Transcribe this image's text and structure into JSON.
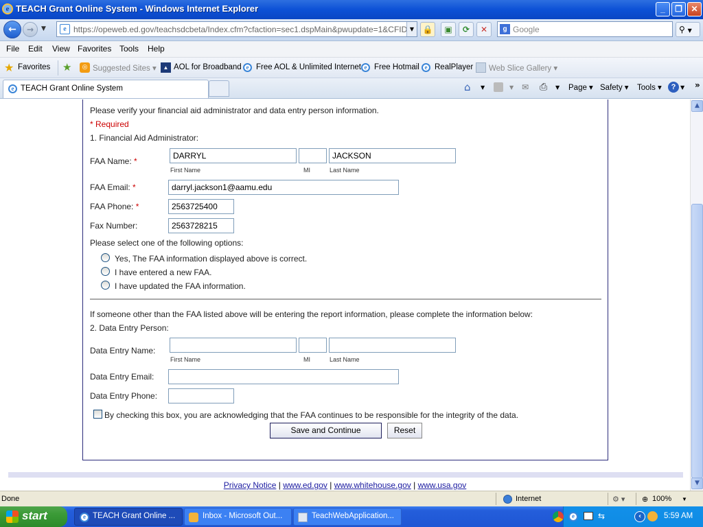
{
  "window": {
    "title": "TEACH Grant Online System - Windows Internet Explorer"
  },
  "navbar": {
    "url": "https://opeweb.ed.gov/teachsdcbeta/Index.cfm?cfaction=sec1.dspMain&pwupdate=1&CFID=4792",
    "search_placeholder": "Google"
  },
  "menu": [
    "File",
    "Edit",
    "View",
    "Favorites",
    "Tools",
    "Help"
  ],
  "favorites": {
    "label": "Favorites",
    "items": [
      "Suggested Sites ▾",
      "AOL for Broadband",
      "Free AOL & Unlimited Internet",
      "Free Hotmail",
      "RealPlayer",
      "Web Slice Gallery ▾"
    ]
  },
  "tabs": {
    "active_tab": "TEACH Grant Online System",
    "tools": [
      "Page ▾",
      "Safety ▾",
      "Tools ▾"
    ]
  },
  "form": {
    "intro": "Please verify your financial aid administrator and data entry person information.",
    "required_note": "* Required",
    "section1": "1. Financial Aid Administrator:",
    "faa_name_label": "FAA Name:",
    "faa_first": "DARRYL",
    "faa_mi": "",
    "faa_last": "JACKSON",
    "first_name_caption": "First Name",
    "mi_caption": "MI",
    "last_name_caption": "Last Name",
    "faa_email_label": "FAA Email:",
    "faa_email": "darryl.jackson1@aamu.edu",
    "faa_phone_label": "FAA Phone:",
    "faa_phone": "2563725400",
    "fax_label": "Fax Number:",
    "fax": "2563728215",
    "options_prompt": "Please select one of the following options:",
    "options": [
      "Yes, The FAA information displayed above is correct.",
      "I have entered a new FAA.",
      "I have updated the FAA information."
    ],
    "someone_else": "If someone other than the FAA listed above will be entering the report information, please complete the information below:",
    "section2": "2. Data Entry Person:",
    "de_name_label": "Data Entry Name:",
    "de_email_label": "Data Entry Email:",
    "de_phone_label": "Data Entry Phone:",
    "acknowledge": "By checking this box, you are acknowledging that the FAA continues to be responsible for the integrity of the data.",
    "save_button": "Save and Continue",
    "reset_button": "Reset"
  },
  "footer": {
    "links": [
      "Privacy Notice",
      "www.ed.gov",
      "www.whitehouse.gov",
      "www.usa.gov"
    ],
    "separator": " | "
  },
  "status": {
    "text": "Done",
    "zone": "Internet",
    "zoom": "100%"
  },
  "taskbar": {
    "start": "start",
    "tasks": [
      "TEACH Grant Online ...",
      "Inbox - Microsoft Out...",
      "TeachWebApplication..."
    ],
    "clock": "5:59 AM"
  }
}
